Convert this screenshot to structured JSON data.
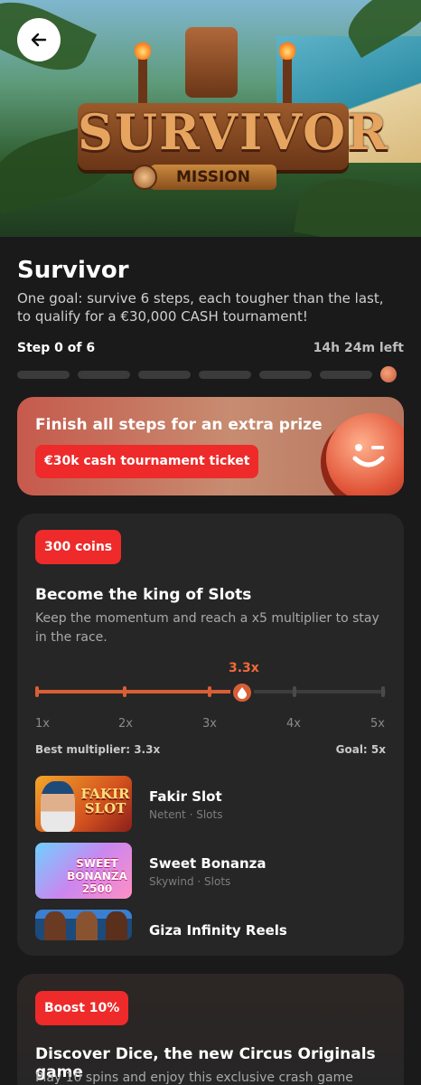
{
  "hero": {
    "logo_text": "SURVIVOR",
    "logo_sub": "MISSION"
  },
  "mission": {
    "title": "Survivor",
    "description": "One goal: survive 6 steps, each tougher than the last, to qualify for a €30,000 CASH tournament!",
    "step_label": "Step 0 of 6",
    "time_left": "14h 24m left",
    "steps_total": 6,
    "steps_done": 0
  },
  "prize": {
    "heading": "Finish all steps for an extra prize",
    "ticket": "€30k cash tournament ticket"
  },
  "step1": {
    "badge": "300 coins",
    "title": "Become the king of Slots",
    "description": "Keep the momentum and reach a x5 multiplier to stay in the race.",
    "current_multiplier": "3.3x",
    "current_value": 3.3,
    "ticks": [
      "1x",
      "2x",
      "3x",
      "4x",
      "5x"
    ],
    "best": "Best multiplier: 3.3x",
    "goal": "Goal: 5x",
    "games": [
      {
        "name": "Fakir Slot",
        "meta": "Netent · Slots",
        "thumb_text": "FAKIR SLOT"
      },
      {
        "name": "Sweet Bonanza",
        "meta": "Skywind · Slots",
        "thumb_text": "SWEET BONANZA 2500"
      },
      {
        "name": "Giza Infinity Reels",
        "meta": ""
      }
    ]
  },
  "step2": {
    "badge": "Boost 10%",
    "title": "Discover Dice, the new Circus Originals game",
    "description": "Play 10 spins and enjoy this exclusive crash game"
  },
  "colors": {
    "accent_red": "#ee2a2a",
    "accent_orange": "#d85f35",
    "background": "#1a1a1a",
    "card": "#262626"
  }
}
